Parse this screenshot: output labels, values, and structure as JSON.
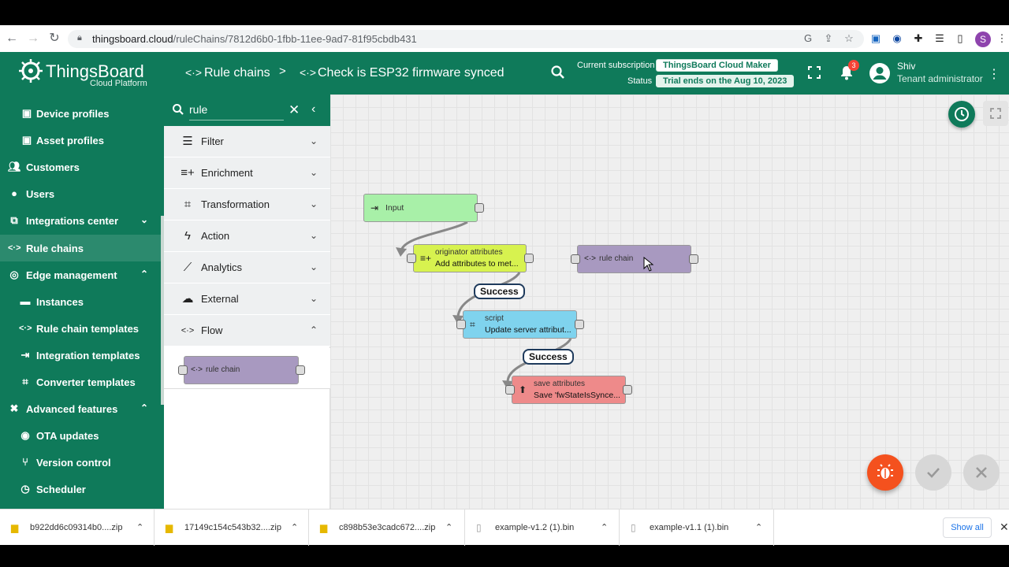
{
  "browser": {
    "url_host": "thingsboard.cloud",
    "url_path": "/ruleChains/7812d6b0-1fbb-11ee-9ad7-81f95cbdb431"
  },
  "header": {
    "brand": "ThingsBoard",
    "brand_sub": "Cloud Platform",
    "breadcrumb_root": "Rule chains",
    "breadcrumb_sep": ">",
    "breadcrumb_current": "Check is ESP32 firmware synced",
    "subscription_label": "Current subscription",
    "subscription_value": "ThingsBoard Cloud Maker",
    "status_label": "Status",
    "status_value": "Trial ends on the Aug 10, 2023",
    "notification_count": "3",
    "user_name": "Shiv",
    "user_role": "Tenant administrator"
  },
  "sidebar": {
    "items": [
      {
        "label": "Device profiles",
        "icon": "device-profile-icon"
      },
      {
        "label": "Asset profiles",
        "icon": "asset-profile-icon"
      },
      {
        "label": "Customers",
        "icon": "customers-icon"
      },
      {
        "label": "Users",
        "icon": "users-icon"
      },
      {
        "label": "Integrations center",
        "icon": "integrations-icon"
      },
      {
        "label": "Rule chains",
        "icon": "rule-chains-icon"
      },
      {
        "label": "Edge management",
        "icon": "edge-icon"
      },
      {
        "label": "Instances",
        "icon": "instances-icon"
      },
      {
        "label": "Rule chain templates",
        "icon": "rule-chain-templates-icon"
      },
      {
        "label": "Integration templates",
        "icon": "integration-templates-icon"
      },
      {
        "label": "Converter templates",
        "icon": "converter-templates-icon"
      },
      {
        "label": "Advanced features",
        "icon": "advanced-features-icon"
      },
      {
        "label": "OTA updates",
        "icon": "ota-icon"
      },
      {
        "label": "Version control",
        "icon": "version-control-icon"
      },
      {
        "label": "Scheduler",
        "icon": "scheduler-icon"
      }
    ]
  },
  "library": {
    "search_value": "rule",
    "categories": [
      {
        "label": "Filter"
      },
      {
        "label": "Enrichment"
      },
      {
        "label": "Transformation"
      },
      {
        "label": "Action"
      },
      {
        "label": "Analytics"
      },
      {
        "label": "External"
      },
      {
        "label": "Flow"
      }
    ],
    "flow_node": "rule chain"
  },
  "canvas": {
    "nodes": [
      {
        "type": "Input",
        "name": ""
      },
      {
        "type": "originator attributes",
        "name": "Add attributes to met..."
      },
      {
        "type": "rule chain",
        "name": ""
      },
      {
        "type": "script",
        "name": "Update server attribut..."
      },
      {
        "type": "save attributes",
        "name": "Save 'fwStateIsSynce..."
      }
    ],
    "relations": [
      "Success",
      "Success"
    ]
  },
  "downloads": {
    "items": [
      {
        "name": "b922dd6c09314b0....zip"
      },
      {
        "name": "17149c154c543b32....zip"
      },
      {
        "name": "c898b53e3cadc672....zip"
      },
      {
        "name": "example-v1.2 (1).bin"
      },
      {
        "name": "example-v1.1 (1).bin"
      }
    ],
    "show_all": "Show all"
  },
  "colors": {
    "primary": "#0f7a5a",
    "input_node": "#a8f0a8",
    "enrichment_node": "#d7f24f",
    "flow_node": "#a899c0",
    "transform_node": "#7fd3ee",
    "action_node": "#ee8a8a",
    "debug_fab": "#f4511e"
  }
}
